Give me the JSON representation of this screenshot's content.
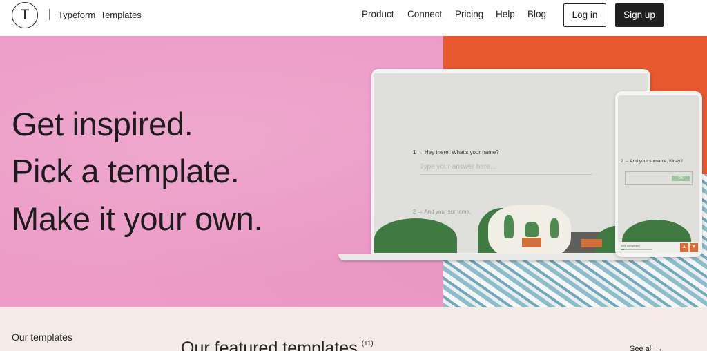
{
  "header": {
    "logo_letter": "T",
    "brand_name": "Typeform",
    "brand_section": "Templates",
    "nav": [
      "Product",
      "Connect",
      "Pricing",
      "Help",
      "Blog"
    ],
    "login_label": "Log in",
    "signup_label": "Sign up"
  },
  "hero": {
    "lines": [
      "Get inspired.",
      "Pick a template.",
      "Make it your own."
    ],
    "laptop": {
      "question_number": "1 →",
      "question": "Hey there! What's your name?",
      "placeholder": "Type your answer here...",
      "next_question_number": "2 →",
      "next_question": "And your surname,"
    },
    "phone": {
      "question_number": "2 →",
      "question": "And your surname, Kirsty?",
      "ok_label": "OK",
      "progress_label": "10% completed",
      "progress": 0.1
    }
  },
  "bottom": {
    "our_templates": "Our templates",
    "featured_title": "Our featured templates",
    "featured_count": "(11)",
    "see_all": "See all →"
  },
  "colors": {
    "pink": "#ec9cc7",
    "orange": "#e8582f",
    "teal": "#8dbccb",
    "dark": "#1f1f1f",
    "beige": "#f3ebe4"
  }
}
